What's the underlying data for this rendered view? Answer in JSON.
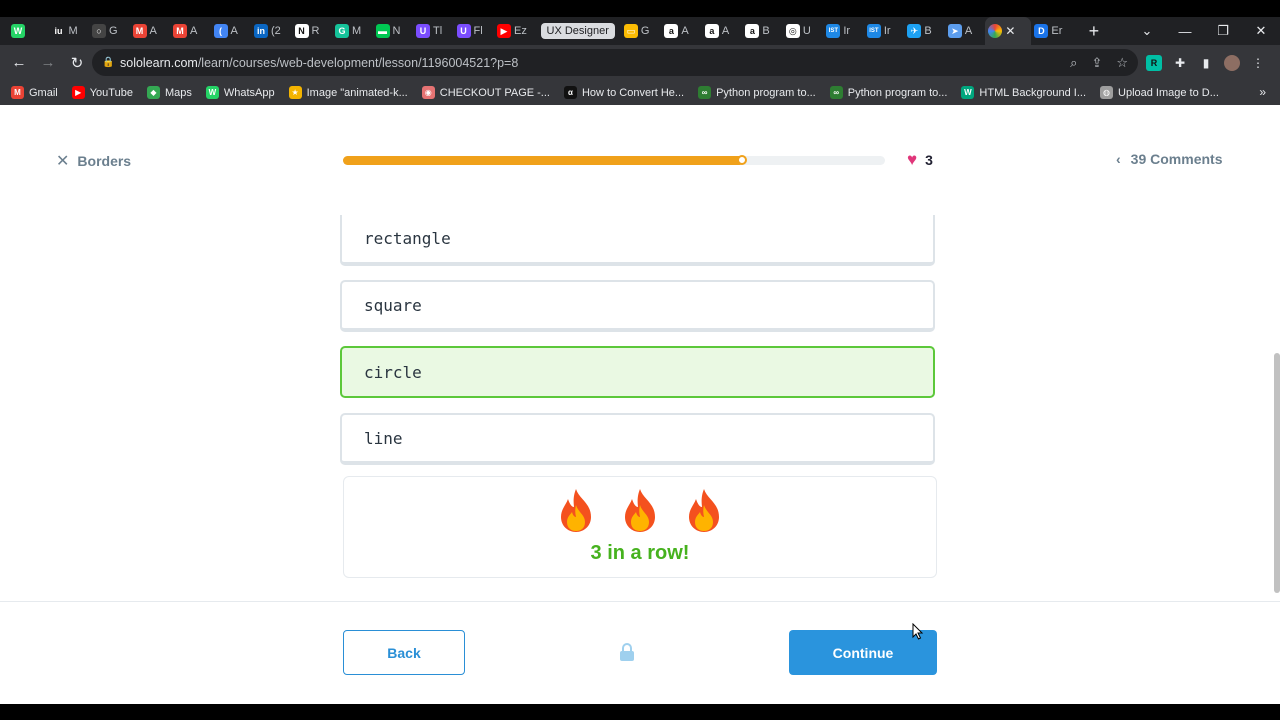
{
  "browser": {
    "tabs": [
      {
        "icon": "whatsapp-icon",
        "label": "",
        "color": "#25d366",
        "glyph": "W"
      },
      {
        "icon": "ui-icon",
        "label": "M",
        "color": "#202124",
        "glyph": "iu"
      },
      {
        "icon": "github-icon",
        "label": "G",
        "color": "#444",
        "glyph": "○"
      },
      {
        "icon": "gmail-icon",
        "label": "A",
        "color": "#ea4335",
        "glyph": "M"
      },
      {
        "icon": "gmail-icon",
        "label": "A",
        "color": "#ea4335",
        "glyph": "M"
      },
      {
        "icon": "c-icon",
        "label": "A",
        "color": "#4285f4",
        "glyph": "("
      },
      {
        "icon": "linkedin-icon",
        "label": "(2",
        "color": "#0a66c2",
        "glyph": "in"
      },
      {
        "icon": "notion-icon",
        "label": "R",
        "color": "#fff",
        "glyph": "N"
      },
      {
        "icon": "grammarly-icon",
        "label": "M",
        "color": "#15c39a",
        "glyph": "G"
      },
      {
        "icon": "bar-icon",
        "label": "N",
        "color": "#00c853",
        "glyph": "▬"
      },
      {
        "icon": "u-icon",
        "label": "Tl",
        "color": "#7b4dff",
        "glyph": "U"
      },
      {
        "icon": "u-icon",
        "label": "Fl",
        "color": "#7b4dff",
        "glyph": "U"
      },
      {
        "icon": "youtube-icon",
        "label": "Ez",
        "color": "#ff0000",
        "glyph": "▶"
      }
    ],
    "group_label": "UX Designer",
    "tabs_after": [
      {
        "icon": "slides-icon",
        "label": "G",
        "color": "#fbbc04",
        "glyph": "▭"
      },
      {
        "icon": "amazon-icon",
        "label": "A",
        "color": "#fff",
        "glyph": "a"
      },
      {
        "icon": "amazon-icon",
        "label": "A",
        "color": "#fff",
        "glyph": "a"
      },
      {
        "icon": "amazon-icon",
        "label": "B",
        "color": "#fff",
        "glyph": "a"
      },
      {
        "icon": "globe-icon",
        "label": "U",
        "color": "#bbb",
        "glyph": "◎"
      },
      {
        "icon": "ist-icon",
        "label": "Ir",
        "color": "#1e88e5",
        "glyph": "IST"
      },
      {
        "icon": "ist-icon",
        "label": "Ir",
        "color": "#1e88e5",
        "glyph": "IST"
      },
      {
        "icon": "bird-icon",
        "label": "B",
        "color": "#1da1f2",
        "glyph": "✈"
      },
      {
        "icon": "send-icon",
        "label": "A",
        "color": "#5c9ded",
        "glyph": "➤"
      }
    ],
    "tabs_tail": [
      {
        "icon": "d-icon",
        "label": "Er",
        "color": "#1a73e8",
        "glyph": "D"
      }
    ],
    "url_host": "sololearn.com",
    "url_path": "/learn/courses/web-development/lesson/1196004521?p=8",
    "bookmarks": [
      {
        "icon": "gmail-icon",
        "label": "Gmail",
        "color": "#ea4335",
        "glyph": "M"
      },
      {
        "icon": "youtube-icon",
        "label": "YouTube",
        "color": "#ff0000",
        "glyph": "▶"
      },
      {
        "icon": "maps-icon",
        "label": "Maps",
        "color": "#34a853",
        "glyph": "◆"
      },
      {
        "icon": "whatsapp-icon",
        "label": "WhatsApp",
        "color": "#25d366",
        "glyph": "W"
      },
      {
        "icon": "star-icon",
        "label": "Image \"animated-k...",
        "color": "#f4b400",
        "glyph": "★"
      },
      {
        "icon": "cart-icon",
        "label": "CHECKOUT PAGE -...",
        "color": "#e57373",
        "glyph": "◉"
      },
      {
        "icon": "alpha-icon",
        "label": "How to Convert He...",
        "color": "#111",
        "glyph": "α"
      },
      {
        "icon": "python-icon",
        "label": "Python program to...",
        "color": "#2e7d32",
        "glyph": "∞"
      },
      {
        "icon": "python-icon",
        "label": "Python program to...",
        "color": "#2e7d32",
        "glyph": "∞"
      },
      {
        "icon": "code-icon",
        "label": "HTML Background I...",
        "color": "#00a67e",
        "glyph": "W"
      },
      {
        "icon": "globe-icon",
        "label": "Upload Image to D...",
        "color": "#9e9e9e",
        "glyph": "◍"
      }
    ]
  },
  "lesson": {
    "title": "Borders",
    "progress_percent": 74,
    "hearts": "3",
    "comments": "39 Comments"
  },
  "options": [
    {
      "label": "rectangle",
      "state": "default"
    },
    {
      "label": "square",
      "state": "default"
    },
    {
      "label": "circle",
      "state": "correct"
    },
    {
      "label": "line",
      "state": "default"
    }
  ],
  "streak": {
    "text": "3 in a row!",
    "flames": 3
  },
  "footer": {
    "back_label": "Back",
    "continue_label": "Continue"
  },
  "colors": {
    "accent": "#2a94dd",
    "progress": "#f0a11a",
    "correct": "#5cc83a",
    "streak_text": "#46b21e",
    "heart": "#e0367a"
  }
}
